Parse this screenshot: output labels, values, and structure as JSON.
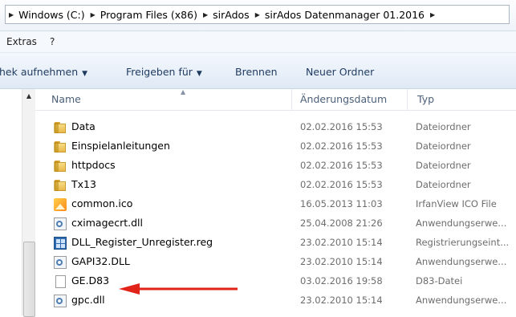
{
  "address": {
    "crumbs": [
      "Windows (C:)",
      "Program Files (x86)",
      "sirAdos",
      "sirAdos Datenmanager 01.2016"
    ]
  },
  "menu": {
    "items": [
      "Extras",
      "?"
    ]
  },
  "toolbar": {
    "library_label": "hek aufnehmen",
    "share_label": "Freigeben für",
    "burn_label": "Brennen",
    "new_folder_label": "Neuer Ordner"
  },
  "columns": {
    "name": "Name",
    "date": "Änderungsdatum",
    "type": "Typ"
  },
  "files": [
    {
      "name": "Data",
      "date": "02.02.2016 15:53",
      "type": "Dateiordner",
      "icon": "folder-icon"
    },
    {
      "name": "Einspielanleitungen",
      "date": "02.02.2016 15:53",
      "type": "Dateiordner",
      "icon": "folder-icon"
    },
    {
      "name": "httpdocs",
      "date": "02.02.2016 15:53",
      "type": "Dateiordner",
      "icon": "folder-icon"
    },
    {
      "name": "Tx13",
      "date": "02.02.2016 15:53",
      "type": "Dateiordner",
      "icon": "folder-icon"
    },
    {
      "name": "common.ico",
      "date": "16.05.2013 11:03",
      "type": "IrfanView ICO File",
      "icon": "image-icon"
    },
    {
      "name": "cximagecrt.dll",
      "date": "25.04.2008 21:26",
      "type": "Anwendungserwe...",
      "icon": "dll-icon"
    },
    {
      "name": "DLL_Register_Unregister.reg",
      "date": "23.02.2010 15:14",
      "type": "Registrierungseint...",
      "icon": "registry-icon"
    },
    {
      "name": "GAPI32.DLL",
      "date": "23.02.2010 15:14",
      "type": "Anwendungserwe...",
      "icon": "dll-icon"
    },
    {
      "name": "GE.D83",
      "date": "03.02.2016 19:58",
      "type": "D83-Datei",
      "icon": "file-icon"
    },
    {
      "name": "gpc.dll",
      "date": "23.02.2010 15:14",
      "type": "Anwendungserwe...",
      "icon": "dll-icon"
    }
  ],
  "colors": {
    "annotation_arrow": "#e2231a",
    "folder": "#f0c75e",
    "toolbar_text": "#1e3a5f"
  }
}
